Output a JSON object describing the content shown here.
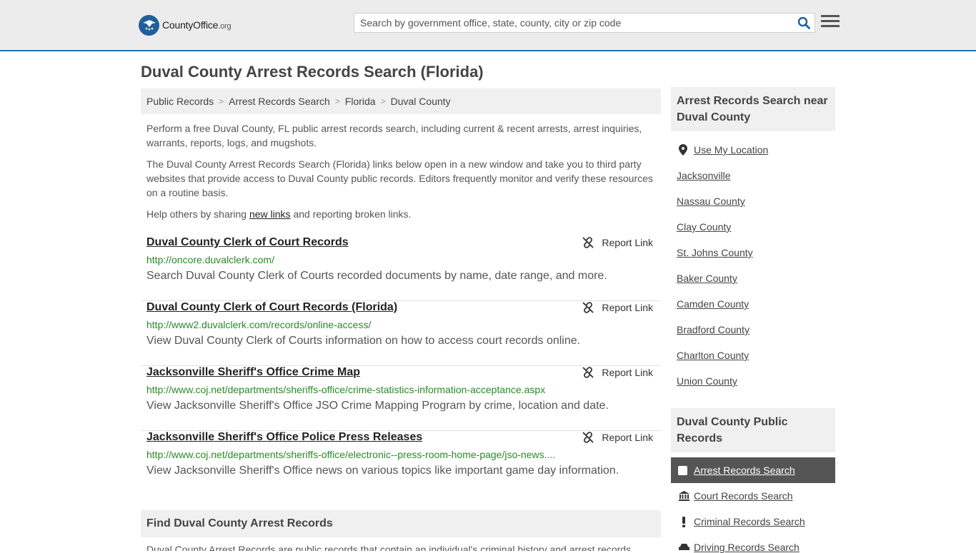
{
  "header": {
    "logo_main": "CountyOffice",
    "logo_domain": ".org",
    "search_placeholder": "Search by government office, state, county, city or zip code"
  },
  "page_title": "Duval County Arrest Records Search (Florida)",
  "breadcrumb": [
    "Public Records",
    "Arrest Records Search",
    "Florida",
    "Duval County"
  ],
  "intro": {
    "p1": "Perform a free Duval County, FL public arrest records search, including current & recent arrests, arrest inquiries, warrants, reports, logs, and mugshots.",
    "p2": "The Duval County Arrest Records Search (Florida) links below open in a new window and take you to third party websites that provide access to Duval County public records. Editors frequently monitor and verify these resources on a routine basis.",
    "p3_before": "Help others by sharing ",
    "p3_link": "new links",
    "p3_after": " and reporting broken links."
  },
  "report_label": "Report Link",
  "results": [
    {
      "title": "Duval County Clerk of Court Records",
      "url": "http://oncore.duvalclerk.com/",
      "desc": "Search Duval County Clerk of Courts recorded documents by name, date range, and more."
    },
    {
      "title": "Duval County Clerk of Court Records (Florida)",
      "url": "http://www2.duvalclerk.com/records/online-access/",
      "desc": "View Duval County Clerk of Courts information on how to access court records online."
    },
    {
      "title": "Jacksonville Sheriff's Office Crime Map",
      "url": "http://www.coj.net/departments/sheriffs-office/crime-statistics-information-acceptance.aspx",
      "desc": "View Jacksonville Sheriff's Office JSO Crime Mapping Program by crime, location and date."
    },
    {
      "title": "Jacksonville Sheriff's Office Police Press Releases",
      "url": "http://www.coj.net/departments/sheriffs-office/electronic--press-room-home-page/jso-news....",
      "desc": "View Jacksonville Sheriff's Office news on various topics like important game day information."
    }
  ],
  "find_section": {
    "title": "Find Duval County Arrest Records",
    "text": "Duval County Arrest Records are public records that contain an individual's criminal history and arrest records"
  },
  "sidebar": {
    "nearby_title": "Arrest Records Search near Duval County",
    "use_location": "Use My Location",
    "nearby": [
      "Jacksonville",
      "Nassau County",
      "Clay County",
      "St. Johns County",
      "Baker County",
      "Camden County",
      "Bradford County",
      "Charlton County",
      "Union County"
    ],
    "public_title": "Duval County Public Records",
    "public_links": [
      "Arrest Records Search",
      "Court Records Search",
      "Criminal Records Search",
      "Driving Records Search"
    ]
  },
  "colors": {
    "accent": "#2a6db0",
    "url_green": "#2a8a2a",
    "active_bg": "#555555"
  }
}
